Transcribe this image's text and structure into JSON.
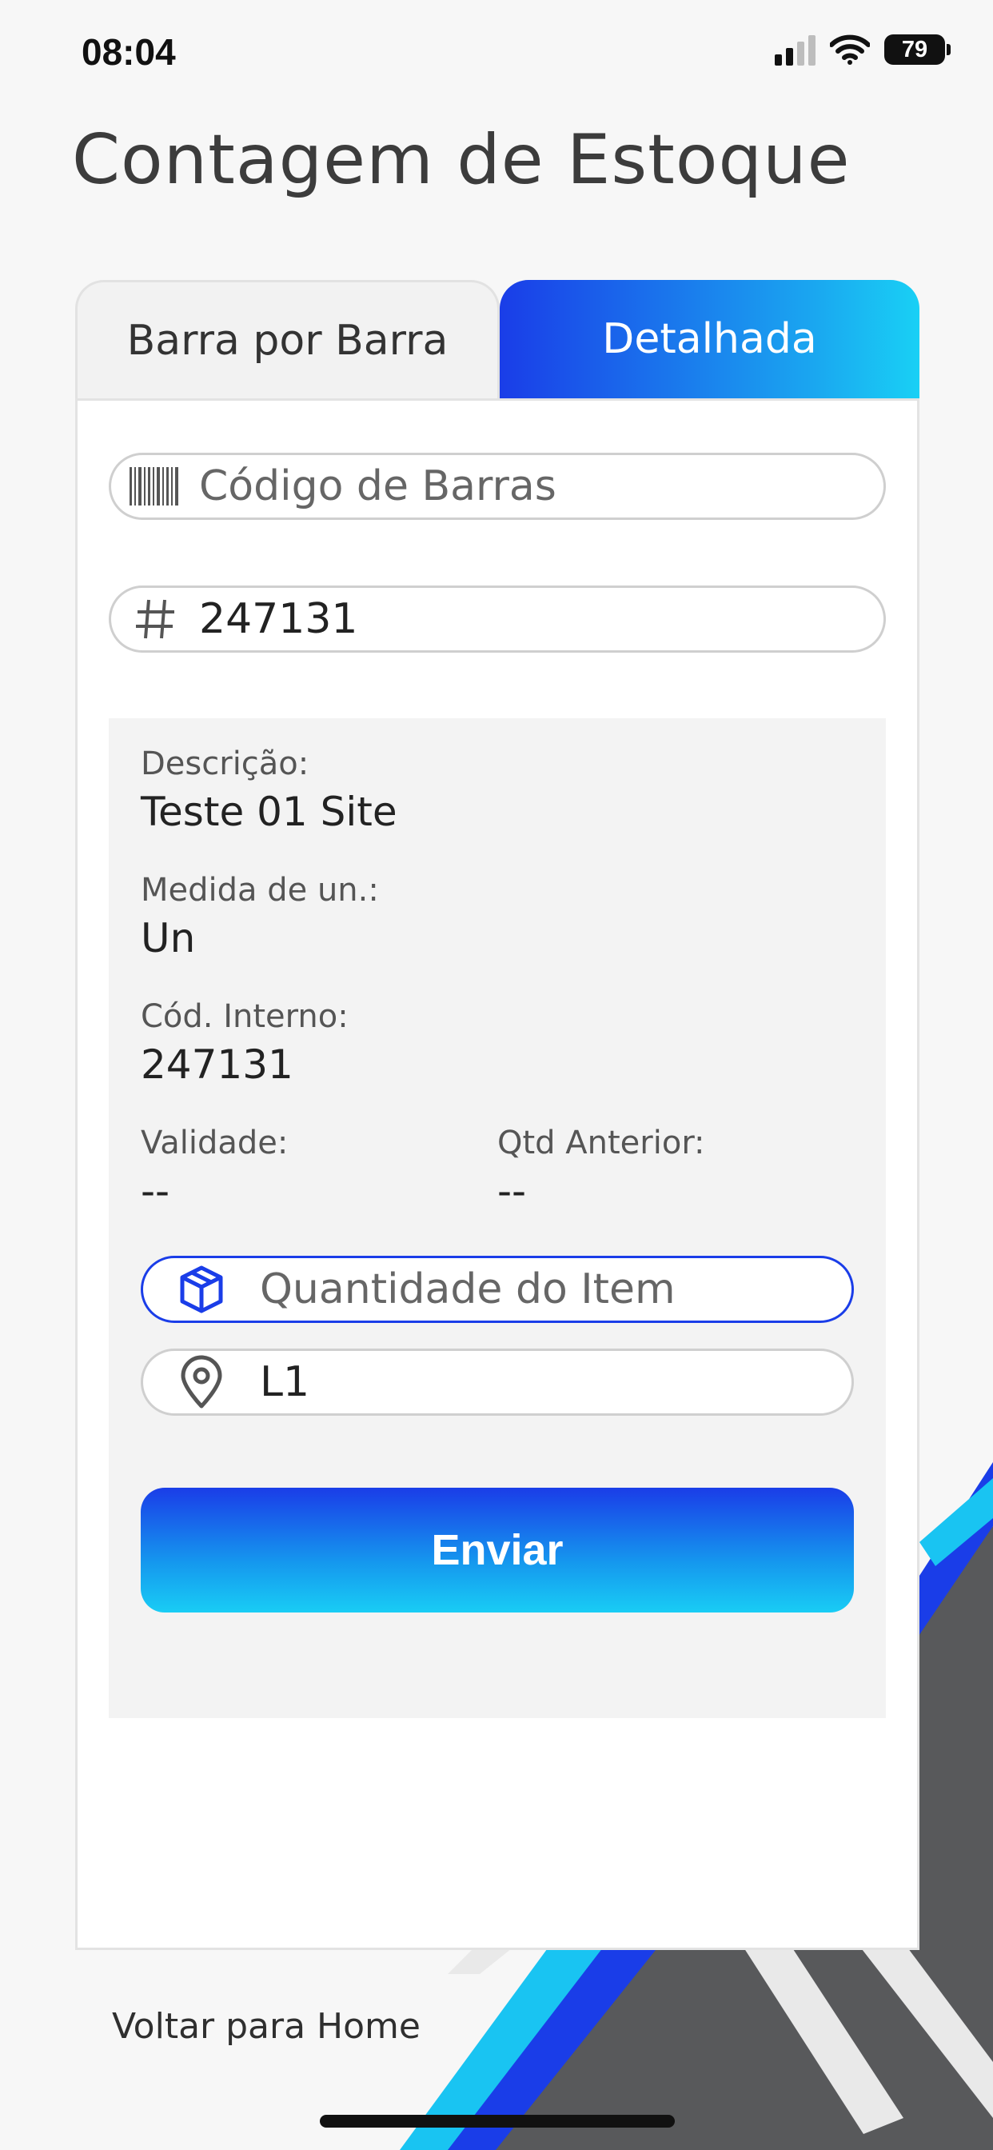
{
  "status": {
    "time": "08:04",
    "battery": "79"
  },
  "title": "Contagem de Estoque",
  "tabs": [
    {
      "label": "Barra por Barra",
      "active": false
    },
    {
      "label": "Detalhada",
      "active": true
    }
  ],
  "barcode_field": {
    "placeholder": "Código de Barras",
    "icon": "barcode-icon"
  },
  "code_field": {
    "value": "247131",
    "icon": "hash-icon"
  },
  "details": {
    "description_label": "Descrição:",
    "description_value": "Teste 01 Site",
    "unit_label": "Medida de un.:",
    "unit_value": "Un",
    "internal_code_label": "Cód. Interno:",
    "internal_code_value": "247131",
    "validity_label": "Validade:",
    "validity_value": "--",
    "previous_qty_label": "Qtd Anterior:",
    "previous_qty_value": "--"
  },
  "quantity_field": {
    "placeholder": "Quantidade do Item",
    "icon": "box-icon"
  },
  "location_field": {
    "value": "L1",
    "icon": "location-pin-icon"
  },
  "send_button": {
    "label": "Enviar"
  },
  "home_link": {
    "label": "Voltar para Home"
  },
  "colors": {
    "accent": "#1a3de8",
    "accent_light": "#19d0f5",
    "text": "#2d2d2d"
  }
}
